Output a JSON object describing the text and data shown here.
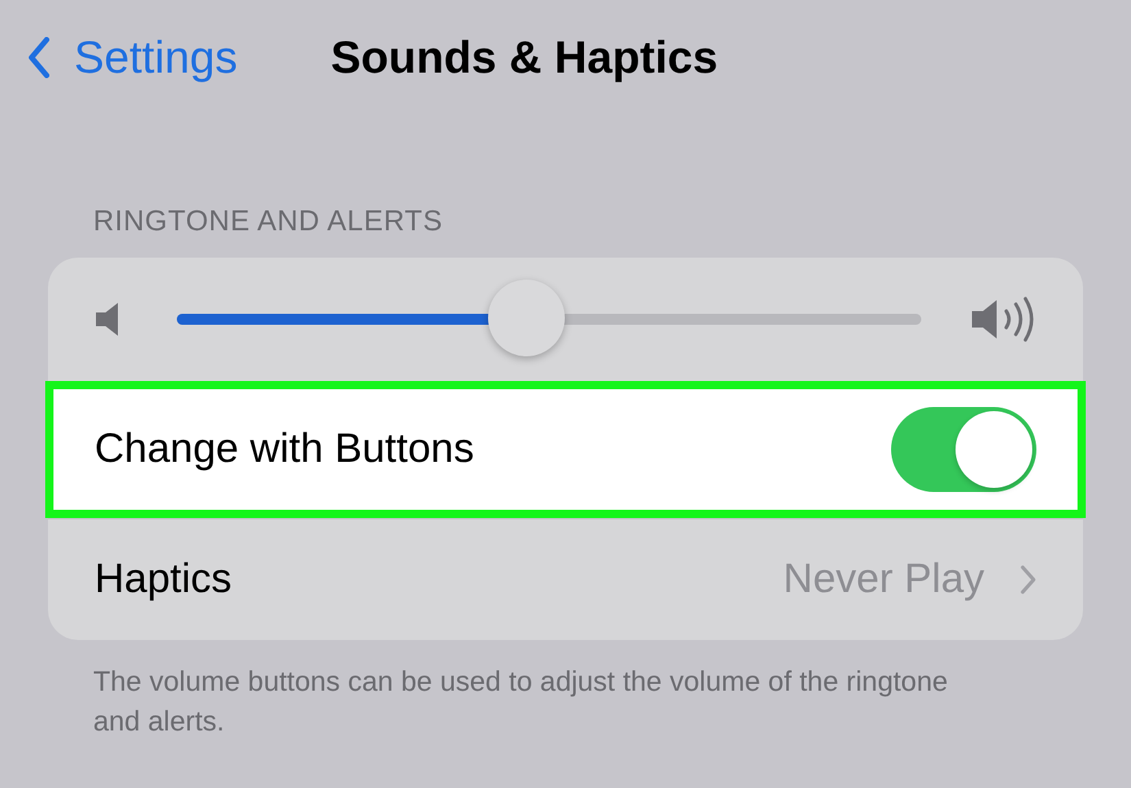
{
  "nav": {
    "back_label": "Settings",
    "title": "Sounds & Haptics"
  },
  "section": {
    "header": "RINGTONE AND ALERTS",
    "volume": {
      "level": 0.47
    },
    "rows": [
      {
        "kind": "toggle",
        "label": "Change with Buttons",
        "on": true,
        "highlighted": true
      },
      {
        "kind": "link",
        "label": "Haptics",
        "value": "Never Play",
        "highlighted": false
      }
    ],
    "footer": "The volume buttons can be used to adjust the volume of the ringtone and alerts."
  }
}
